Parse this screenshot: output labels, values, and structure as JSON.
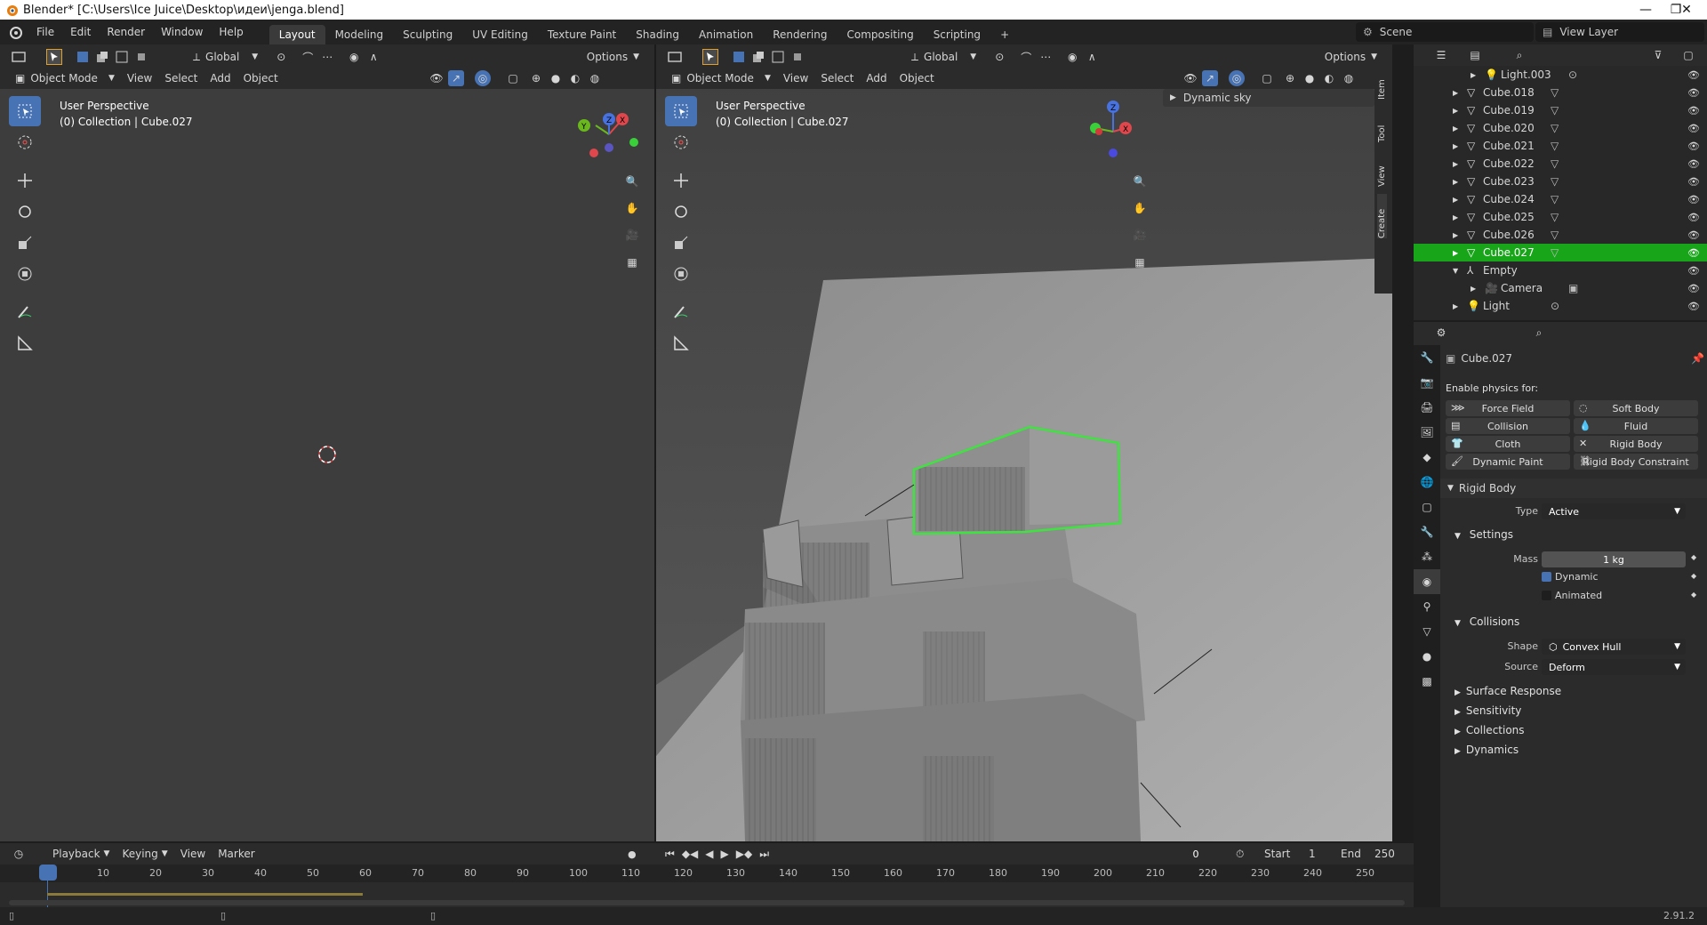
{
  "window": {
    "title": "Blender* [C:\\Users\\Ice Juice\\Desktop\\идеи\\jenga.blend]",
    "min_symbol": "—",
    "max_symbol": "❐",
    "close_symbol": "✕"
  },
  "menu": [
    "File",
    "Edit",
    "Render",
    "Window",
    "Help"
  ],
  "workspaces": [
    "Layout",
    "Modeling",
    "Sculpting",
    "UV Editing",
    "Texture Paint",
    "Shading",
    "Animation",
    "Rendering",
    "Compositing",
    "Scripting",
    "+"
  ],
  "active_workspace": "Layout",
  "scene_name": "Scene",
  "view_layer": "View Layer",
  "left_viewport": {
    "transform_orientation": "Global",
    "options_label": "Options",
    "mode": "Object Mode",
    "menus": [
      "View",
      "Select",
      "Add",
      "Object"
    ],
    "info_line1": "User Perspective",
    "info_line2": "(0) Collection | Cube.027"
  },
  "right_viewport": {
    "transform_orientation": "Global",
    "options_label": "Options",
    "mode": "Object Mode",
    "menus": [
      "View",
      "Select",
      "Add",
      "Object"
    ],
    "info_line1": "User Perspective",
    "info_line2": "(0) Collection | Cube.027",
    "sidebar_panel": "Dynamic sky",
    "sidebar_tabs": [
      "Item",
      "Tool",
      "View",
      "Create"
    ]
  },
  "outliner": {
    "rows": [
      {
        "name": "Light.003",
        "type": "light",
        "indent": 1,
        "expanded": false
      },
      {
        "name": "Cube.018",
        "type": "mesh",
        "indent": 0,
        "expanded": false
      },
      {
        "name": "Cube.019",
        "type": "mesh",
        "indent": 0,
        "expanded": false
      },
      {
        "name": "Cube.020",
        "type": "mesh",
        "indent": 0,
        "expanded": false
      },
      {
        "name": "Cube.021",
        "type": "mesh",
        "indent": 0,
        "expanded": false
      },
      {
        "name": "Cube.022",
        "type": "mesh",
        "indent": 0,
        "expanded": false
      },
      {
        "name": "Cube.023",
        "type": "mesh",
        "indent": 0,
        "expanded": false
      },
      {
        "name": "Cube.024",
        "type": "mesh",
        "indent": 0,
        "expanded": false
      },
      {
        "name": "Cube.025",
        "type": "mesh",
        "indent": 0,
        "expanded": false
      },
      {
        "name": "Cube.026",
        "type": "mesh",
        "indent": 0,
        "expanded": false
      },
      {
        "name": "Cube.027",
        "type": "mesh",
        "indent": 0,
        "expanded": false,
        "selected": true
      },
      {
        "name": "Empty",
        "type": "empty",
        "indent": 0,
        "expanded": true
      },
      {
        "name": "Camera",
        "type": "camera",
        "indent": 1,
        "expanded": false
      },
      {
        "name": "Light",
        "type": "light",
        "indent": 0,
        "expanded": false
      }
    ]
  },
  "properties": {
    "object_name": "Cube.027",
    "enable_physics_label": "Enable physics for:",
    "physics_buttons": [
      "Force Field",
      "Soft Body",
      "Collision",
      "Fluid",
      "Cloth",
      "Rigid Body",
      "Dynamic Paint",
      "Rigid Body Constraint"
    ],
    "rigid_body_label": "Rigid Body",
    "type_label": "Type",
    "type_value": "Active",
    "settings_label": "Settings",
    "mass_label": "Mass",
    "mass_value": "1 kg",
    "dynamic_label": "Dynamic",
    "animated_label": "Animated",
    "collisions_label": "Collisions",
    "shape_label": "Shape",
    "shape_value": "Convex Hull",
    "source_label": "Source",
    "source_value": "Deform",
    "subpanels": [
      "Surface Response",
      "Sensitivity",
      "Collections",
      "Dynamics"
    ]
  },
  "timeline": {
    "menus": [
      "Playback",
      "Keying",
      "View",
      "Marker"
    ],
    "current_frame": "0",
    "start_label": "Start",
    "start_value": "1",
    "end_label": "End",
    "end_value": "250",
    "ruler": [
      "0",
      "10",
      "20",
      "30",
      "40",
      "50",
      "60",
      "70",
      "80",
      "90",
      "100",
      "110",
      "120",
      "130",
      "140",
      "150",
      "160",
      "170",
      "180",
      "190",
      "200",
      "210",
      "220",
      "230",
      "240",
      "250"
    ]
  },
  "status": {
    "version": "2.91.2"
  },
  "colors": {
    "accent": "#4772b3",
    "selection": "#18a519",
    "viewport": "#3d3d3d",
    "panel": "#2b2b2b"
  }
}
